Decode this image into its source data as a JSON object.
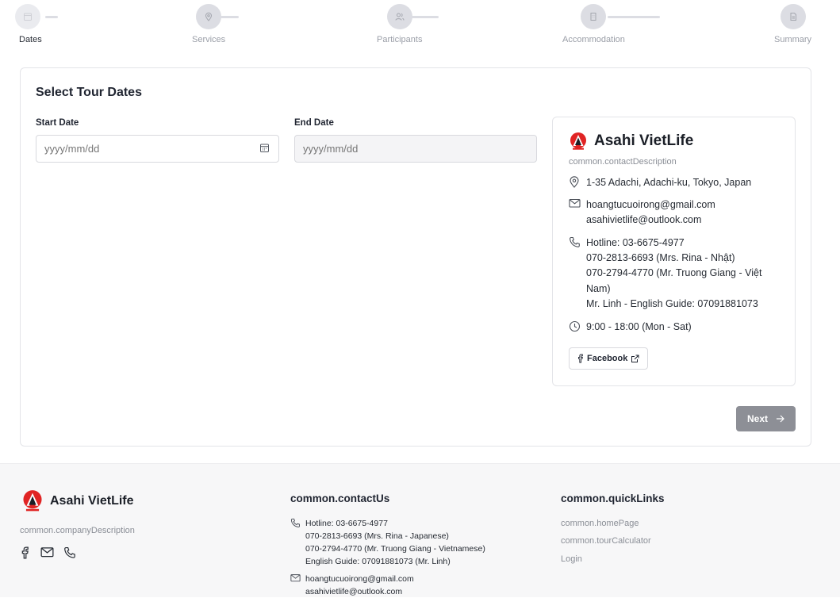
{
  "stepper": {
    "steps": [
      {
        "label": "Dates",
        "icon": "calendar-icon",
        "active": true
      },
      {
        "label": "Services",
        "icon": "map-pin-icon",
        "active": false
      },
      {
        "label": "Participants",
        "icon": "users-icon",
        "active": false
      },
      {
        "label": "Accommodation",
        "icon": "building-icon",
        "active": false
      },
      {
        "label": "Summary",
        "icon": "document-icon",
        "active": false
      }
    ]
  },
  "form": {
    "title": "Select Tour Dates",
    "start_label": "Start Date",
    "start_placeholder": "yyyy/mm/dd",
    "end_label": "End Date",
    "end_placeholder": "yyyy/mm/dd",
    "next_label": "Next"
  },
  "contact": {
    "brand": "Asahi VietLife",
    "description": "common.contactDescription",
    "address": "1-35 Adachi, Adachi-ku, Tokyo, Japan",
    "emails": [
      "hoangtucuoirong@gmail.com",
      "asahivietlife@outlook.com"
    ],
    "phones": [
      "Hotline: 03-6675-4977",
      "070-2813-6693 (Mrs. Rina - Nhật)",
      "070-2794-4770 (Mr. Truong Giang - Việt Nam)",
      "Mr. Linh - English Guide: 07091881073"
    ],
    "hours": "9:00 - 18:00 (Mon - Sat)",
    "facebook_label": "Facebook"
  },
  "footer": {
    "brand": "Asahi VietLife",
    "description": "common.companyDescription",
    "contact_heading": "common.contactUs",
    "phones": [
      "Hotline: 03-6675-4977",
      "070-2813-6693 (Mrs. Rina - Japanese)",
      "070-2794-4770 (Mr. Truong Giang - Vietnamese)",
      "English Guide: 07091881073 (Mr. Linh)"
    ],
    "emails": [
      "hoangtucuoirong@gmail.com",
      "asahivietlife@outlook.com"
    ],
    "links_heading": "common.quickLinks",
    "links": [
      "common.homePage",
      "common.tourCalculator",
      "Login"
    ]
  },
  "colors": {
    "accent_red": "#e02424",
    "button_disabled": "#8d8f96",
    "step_inactive": "#dcdde3"
  }
}
